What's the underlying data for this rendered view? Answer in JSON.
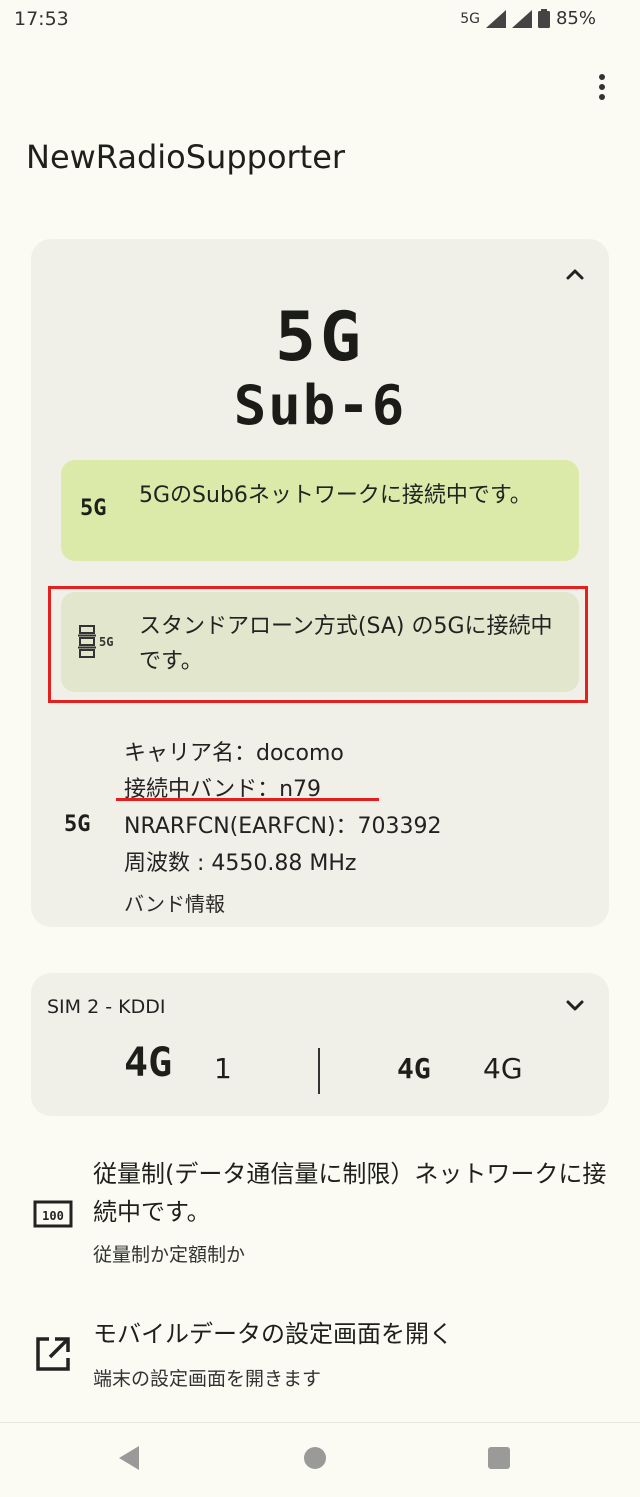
{
  "status_bar": {
    "time": "17:53",
    "network": "5G",
    "battery": "85%",
    "icons": [
      "signal-icon",
      "signal-icon",
      "battery-icon"
    ]
  },
  "app": {
    "title": "NewRadioSupporter"
  },
  "sim1": {
    "network_type": "5G",
    "network_sub": "Sub-6",
    "status_card": {
      "icon_label": "5G",
      "message": "5GのSub6ネットワークに接続中です。"
    },
    "sa_card": {
      "icon": "standalone-5g-icon",
      "message": "スタンドアローン方式(SA) の5Gに接続中です。"
    },
    "info": {
      "icon_label": "5G",
      "carrier": "キャリア名：docomo",
      "band": "接続中バンド：n79",
      "arfcn": "NRARFCN(EARFCN)：703392",
      "frequency": "周波数 : 4550.88 MHz",
      "band_info_link": "バンド情報"
    }
  },
  "sim2": {
    "title": "SIM 2 - KDDI",
    "left_network": "4G",
    "left_value": "1",
    "right_network": "4G",
    "right_value": "4G"
  },
  "metered": {
    "icon_label": "100",
    "title": "従量制(データ通信量に制限）ネットワークに接続中です。",
    "subtitle": "従量制か定額制か"
  },
  "mobile_settings": {
    "icon": "open-in-new-icon",
    "title": "モバイルデータの設定画面を開く",
    "subtitle": "端末の設定画面を開きます"
  },
  "colors": {
    "background": "#fbfbf4",
    "card": "#f1f0e8",
    "green_card": "#dbeaa8",
    "sa_card": "#e1e6cc",
    "highlight_red": "#e32020"
  }
}
